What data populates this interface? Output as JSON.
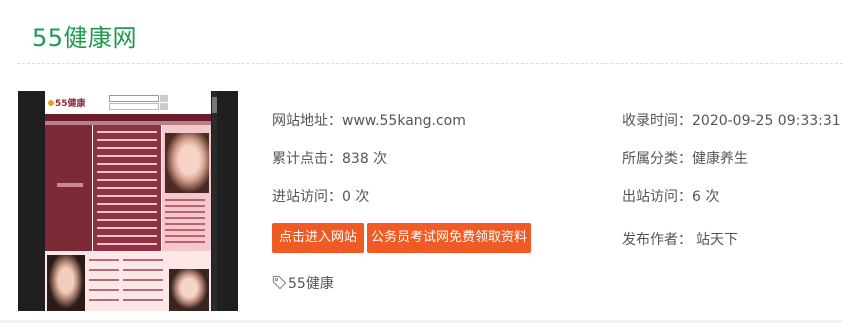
{
  "site": {
    "title": "55健康网"
  },
  "details": {
    "url_label": "网站地址：",
    "url_value": "www.55kang.com",
    "clicks_label": "累计点击：",
    "clicks_value": "838 次",
    "in_label": "进站访问：",
    "in_value": "0 次",
    "recorded_label": "收录时间：",
    "recorded_value": "2020-09-25 09:33:31",
    "category_label": "所属分类：",
    "category_value": "健康养生",
    "out_label": "出站访问：",
    "out_value": "6 次",
    "author_label": "发布作者：",
    "author_value": "站天下"
  },
  "buttons": {
    "visit": "点击进入网站",
    "promo": "公务员考试网免费领取资料"
  },
  "tag": {
    "label": "55健康",
    "icon": "tag-icon"
  },
  "colors": {
    "title": "#1e9b4b",
    "button": "#f05a24"
  }
}
